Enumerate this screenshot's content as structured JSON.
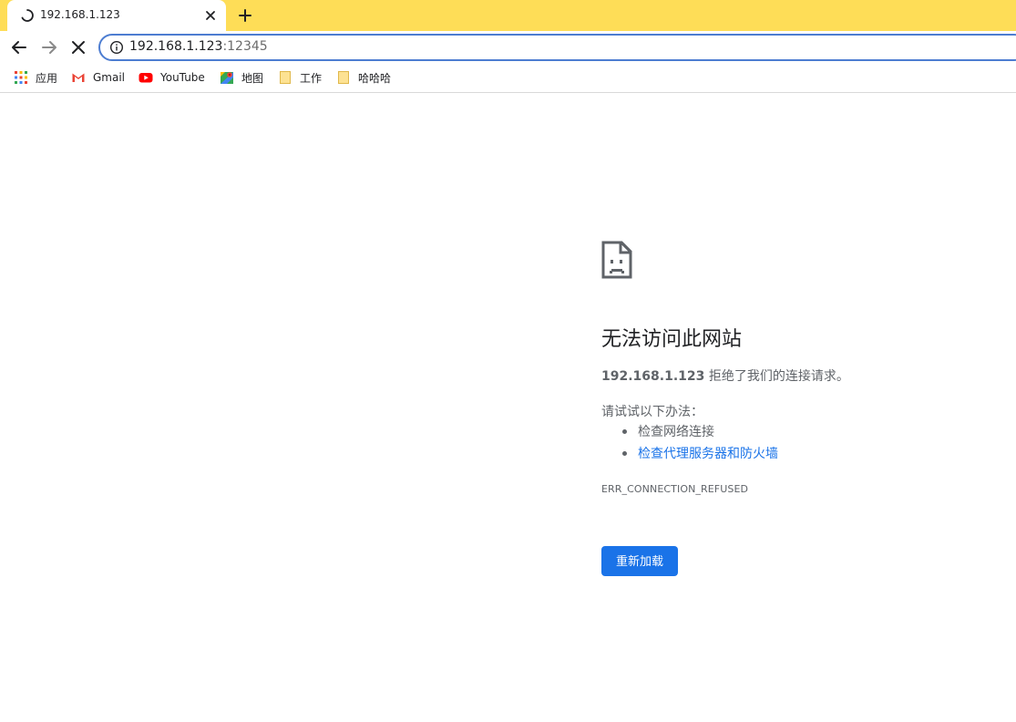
{
  "tab": {
    "title": "192.168.1.123",
    "loading": true
  },
  "toolbar": {
    "url_host": "192.168.1.123",
    "url_port": ":12345"
  },
  "bookmarks": [
    {
      "label": "应用",
      "icon": "apps-grid-icon"
    },
    {
      "label": "Gmail",
      "icon": "gmail-icon"
    },
    {
      "label": "YouTube",
      "icon": "youtube-icon"
    },
    {
      "label": "地图",
      "icon": "maps-icon"
    },
    {
      "label": "工作",
      "icon": "folder-icon"
    },
    {
      "label": "哈哈哈",
      "icon": "folder-icon"
    }
  ],
  "error": {
    "title": "无法访问此网站",
    "host": "192.168.1.123",
    "message": " 拒绝了我们的连接请求。",
    "try_label": "请试试以下办法：",
    "suggestions": [
      {
        "text": "检查网络连接",
        "is_link": false
      },
      {
        "text": "检查代理服务器和防火墙",
        "is_link": true
      }
    ],
    "code": "ERR_CONNECTION_REFUSED",
    "reload_label": "重新加载"
  },
  "colors": {
    "tabstrip": "#fedd57",
    "accent": "#1a73e8",
    "omnibox_border": "#4d7dd1"
  }
}
